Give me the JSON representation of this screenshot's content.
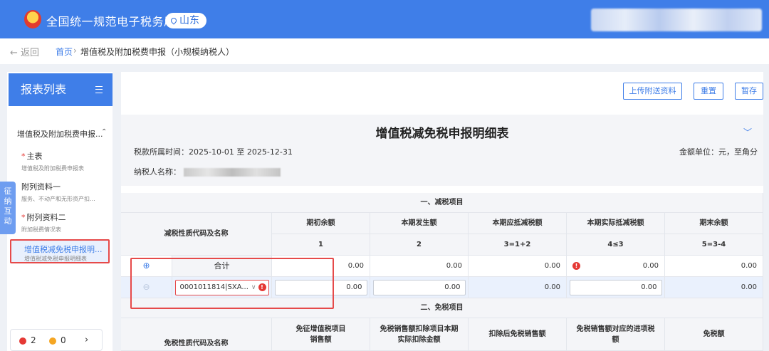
{
  "header": {
    "app_title": "全国统一规范电子税务局",
    "region": "山东"
  },
  "breadcrumb": {
    "back": "← 返回",
    "home": "首页",
    "separator": "›",
    "current": "增值税及附加税费申报（小规模纳税人）"
  },
  "sidebar": {
    "title": "报表列表",
    "group": "增值税及附加税费申报...",
    "items": [
      {
        "label": "主表",
        "sub": "增值税及附加税费申报表",
        "required": "*"
      },
      {
        "label": "附列资料一",
        "sub": "服务、不动产和无形资产扣..."
      },
      {
        "label": "附列资料二",
        "sub": "附加税费情况表",
        "required": "*"
      },
      {
        "label": "增值税减免税申报明...",
        "sub": "增值税减免税申报明细表"
      }
    ],
    "float_tab": [
      "征",
      "纳",
      "互",
      "动"
    ],
    "status": {
      "errors": "2",
      "warnings": "0",
      "next": "›"
    }
  },
  "toolbar": {
    "upload": "上传附送资料",
    "reset": "重置",
    "save": "暂存"
  },
  "form": {
    "title": "增值税减免税申报明细表",
    "period_label": "税款所属时间：",
    "period": "2025-10-01 至 2025-12-31",
    "unit": "金额单位：元，至角分",
    "taxpayer_label": "纳税人名称："
  },
  "table": {
    "section1": "一、减税项目",
    "code_header": "减税性质代码及名称",
    "columns": [
      "期初余额",
      "本期发生额",
      "本期应抵减税额",
      "本期实际抵减税额",
      "期末余额"
    ],
    "col_index": [
      "1",
      "2",
      "3=1+2",
      "4≤3",
      "5=3-4"
    ],
    "total_label": "合计",
    "total_row": [
      "0.00",
      "0.00",
      "0.00",
      "0.00",
      "0.00"
    ],
    "row1_code": "0001011814|SXA...",
    "row1": [
      "0.00",
      "0.00",
      "0.00",
      "0.00",
      "0.00"
    ],
    "section2": "二、免税项目",
    "section2_columns": [
      "免征增值税项目\n销售额",
      "免税销售额扣除项目本期\n实际扣除金额",
      "扣除后免税销售额",
      "免税销售额对应的进项税\n额",
      "免税额"
    ],
    "section2_code_header": "免税性质代码及名称"
  },
  "colors": {
    "primary": "#3f7ee8",
    "alert": "#e53935"
  }
}
